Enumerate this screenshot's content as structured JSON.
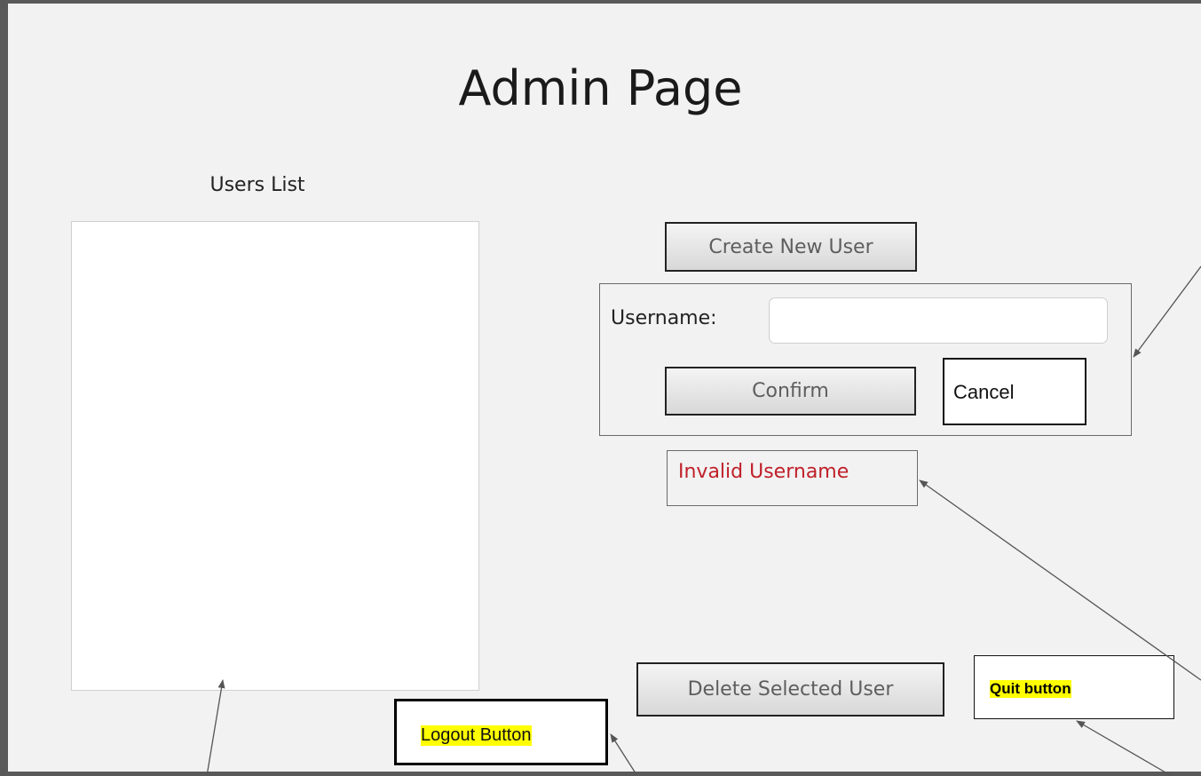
{
  "title": "Admin Page",
  "users_list": {
    "label": "Users List"
  },
  "create_user": {
    "label": "Create New User"
  },
  "form": {
    "username_label": "Username:",
    "username_value": "",
    "confirm_label": "Confirm",
    "cancel_label": "Cancel"
  },
  "error": {
    "message": "Invalid Username",
    "color": "#c0202a"
  },
  "delete_user": {
    "label": "Delete Selected User"
  },
  "annotations": {
    "quit_label": "Quit button",
    "logout_label": "Logout Button",
    "highlight_color": "#ffff00"
  }
}
